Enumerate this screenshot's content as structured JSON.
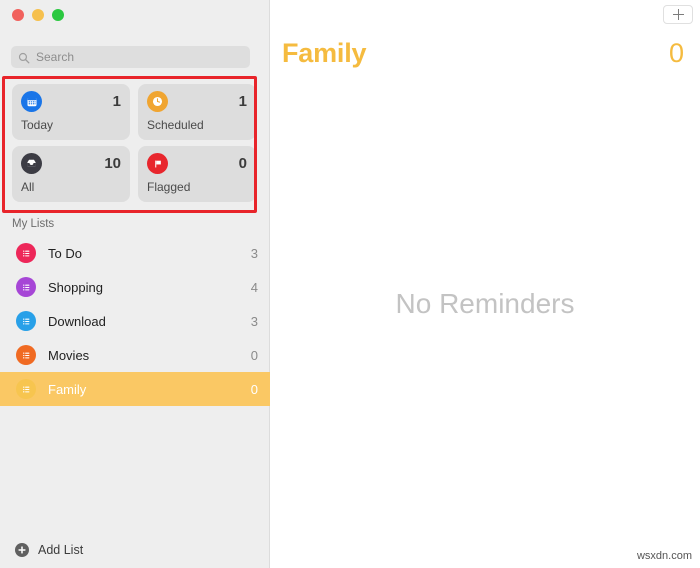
{
  "window": {
    "traffic_lights": [
      {
        "name": "close",
        "color": "#f1615d"
      },
      {
        "name": "minimize",
        "color": "#f6c04d"
      },
      {
        "name": "zoom",
        "color": "#2bc840"
      }
    ]
  },
  "sidebar": {
    "search": {
      "placeholder": "Search",
      "value": "",
      "icon": "search-icon"
    },
    "smart_lists": [
      {
        "key": "today",
        "label": "Today",
        "count": "1",
        "icon": "calendar-icon",
        "color": "#1a75e8"
      },
      {
        "key": "scheduled",
        "label": "Scheduled",
        "count": "1",
        "icon": "clock-icon",
        "color": "#f0a531"
      },
      {
        "key": "all",
        "label": "All",
        "count": "10",
        "icon": "inbox-icon",
        "color": "#3c3c44"
      },
      {
        "key": "flagged",
        "label": "Flagged",
        "count": "0",
        "icon": "flag-icon",
        "color": "#e8262d"
      }
    ],
    "my_lists_header": "My Lists",
    "lists": [
      {
        "key": "todo",
        "label": "To Do",
        "count": "3",
        "icon": "list-icon",
        "color": "#ed2759",
        "selected": false
      },
      {
        "key": "shopping",
        "label": "Shopping",
        "count": "4",
        "icon": "list-icon",
        "color": "#a646d6",
        "selected": false
      },
      {
        "key": "download",
        "label": "Download",
        "count": "3",
        "icon": "list-icon",
        "color": "#28a0e8",
        "selected": false
      },
      {
        "key": "movies",
        "label": "Movies",
        "count": "0",
        "icon": "list-icon",
        "color": "#f06a22",
        "selected": false
      },
      {
        "key": "family",
        "label": "Family",
        "count": "0",
        "icon": "list-icon",
        "color": "#f7c54f",
        "selected": true
      }
    ],
    "add_list": {
      "label": "Add List",
      "icon": "plus-circle-icon"
    }
  },
  "main": {
    "add_reminder": {
      "icon": "plus-icon",
      "label": "+"
    },
    "title": "Family",
    "count": "0",
    "empty_state": "No Reminders",
    "accent_color": "#f5bb3f"
  },
  "annotation": {
    "type": "rectangle-highlight",
    "color": "#e8242a",
    "targets": "smart-lists-grid"
  },
  "watermark": "wsxdn.com"
}
